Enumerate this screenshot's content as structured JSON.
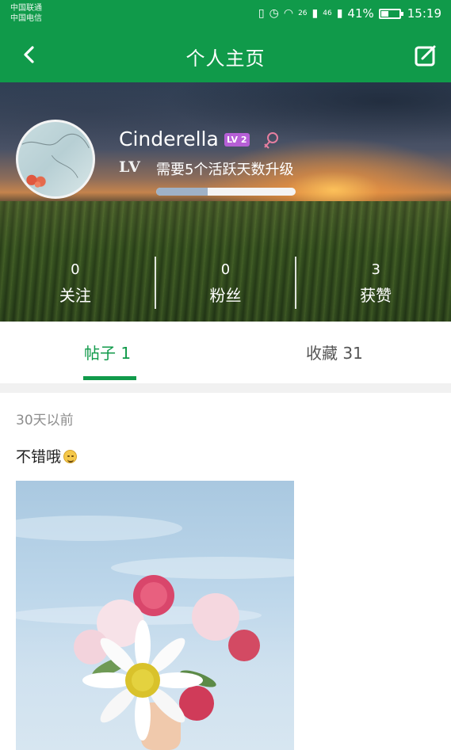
{
  "status_bar": {
    "carrier_1": "中国联通",
    "carrier_2": "中国电信",
    "signal_26": "26",
    "signal_46": "46",
    "battery_percent": "41%",
    "battery_level": 0.41,
    "time": "15:19"
  },
  "header": {
    "title": "个人主页",
    "back_icon": "chevron-left-icon",
    "edit_icon": "edit-square-icon",
    "accent_color": "#109a4a"
  },
  "profile": {
    "username": "Cinderella",
    "level_badge": "LV 2",
    "gender_icon": "female-icon",
    "lv_mark": "LV",
    "level_hint": "需要5个活跃天数升级",
    "level_progress": 0.37
  },
  "stats": [
    {
      "count": "0",
      "label": "关注"
    },
    {
      "count": "0",
      "label": "粉丝"
    },
    {
      "count": "3",
      "label": "获赞"
    }
  ],
  "tabs": [
    {
      "label": "帖子 1",
      "active": true
    },
    {
      "label": "收藏 31",
      "active": false
    }
  ],
  "post": {
    "time": "30天以前",
    "text": "不错哦",
    "emoji_icon": "smiling-face-icon"
  }
}
